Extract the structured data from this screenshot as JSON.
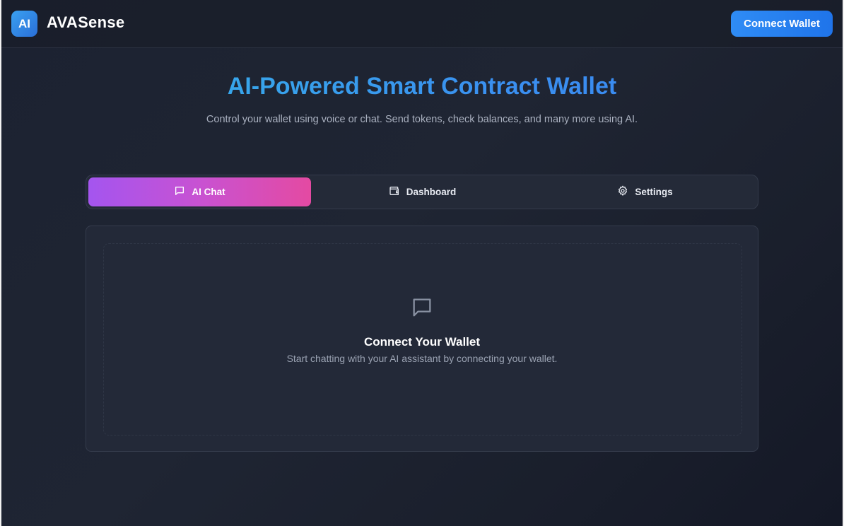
{
  "header": {
    "logo_text": "AI",
    "brand": "AVASense",
    "connect_button": "Connect Wallet"
  },
  "hero": {
    "title": "AI-Powered Smart Contract Wallet",
    "subtitle": "Control your wallet using voice or chat. Send tokens, check balances, and many more using AI."
  },
  "tabs": [
    {
      "label": "AI Chat",
      "icon": "chat-icon",
      "active": true
    },
    {
      "label": "Dashboard",
      "icon": "wallet-icon",
      "active": false
    },
    {
      "label": "Settings",
      "icon": "gear-icon",
      "active": false
    }
  ],
  "empty_state": {
    "icon": "chat-icon",
    "title": "Connect Your Wallet",
    "message": "Start chatting with your AI assistant by connecting your wallet."
  },
  "colors": {
    "accent_blue": "#2f8cf5",
    "tab_gradient_start": "#a455ef",
    "tab_gradient_end": "#e44aa2",
    "background": "#1c2231"
  }
}
